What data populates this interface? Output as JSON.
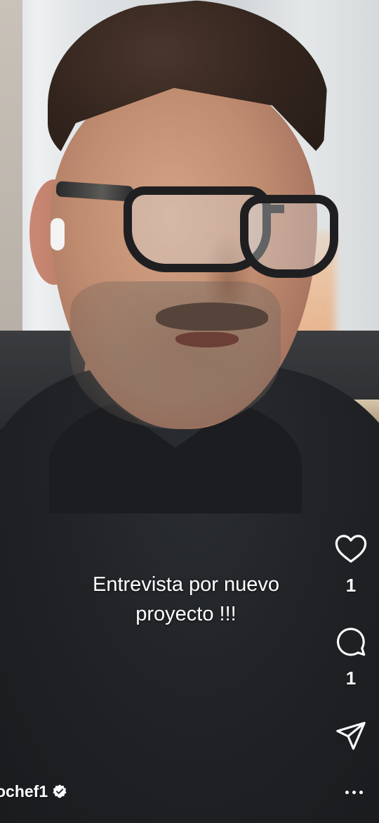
{
  "post": {
    "caption_line1": "Entrevista por nuevo",
    "caption_line2": "proyecto !!!",
    "username": "ochef1"
  },
  "actions": {
    "like_icon": "heart-icon",
    "like_count": "1",
    "comment_icon": "comment-icon",
    "comment_count": "1",
    "share_icon": "paper-plane-icon",
    "more_icon": "more-dots-icon"
  },
  "colors": {
    "overlay_text": "#ffffff",
    "verified_badge": "#ffffff"
  }
}
